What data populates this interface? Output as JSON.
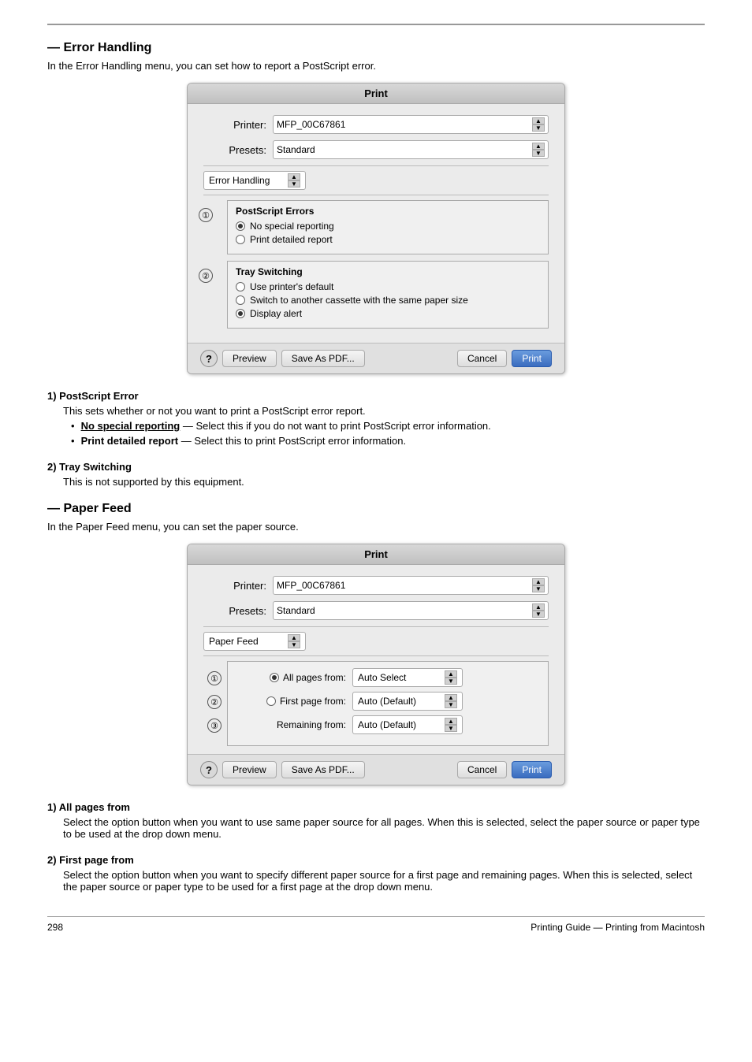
{
  "page": {
    "footer_left": "298",
    "footer_right": "Printing Guide — Printing from Macintosh"
  },
  "error_handling": {
    "section_title": "— Error Handling",
    "intro": "In the Error Handling menu, you can set how to report a PostScript error.",
    "dialog": {
      "title": "Print",
      "printer_label": "Printer:",
      "printer_value": "MFP_00C67861",
      "presets_label": "Presets:",
      "presets_value": "Standard",
      "panel_value": "Error Handling",
      "postscript_group_label": "PostScript Errors",
      "radio1_label": "No special reporting",
      "radio1_checked": true,
      "radio2_label": "Print detailed report",
      "radio2_checked": false,
      "tray_group_label": "Tray Switching",
      "tray_radio1_label": "Use printer's default",
      "tray_radio1_checked": false,
      "tray_radio2_label": "Switch to another cassette with the same paper size",
      "tray_radio2_checked": false,
      "tray_radio3_label": "Display alert",
      "tray_radio3_checked": true,
      "preview_btn": "Preview",
      "save_pdf_btn": "Save As PDF...",
      "cancel_btn": "Cancel",
      "print_btn": "Print"
    },
    "annotation1": "①",
    "annotation2": "②",
    "desc1_heading": "1) PostScript Error",
    "desc1_para": "This sets whether or not you want to print a PostScript error report.",
    "desc1_bullet1_bold": "No special reporting",
    "desc1_bullet1_rest": " — Select this if you do not want to print PostScript error information.",
    "desc1_bullet2_bold": "Print detailed report",
    "desc1_bullet2_rest": " — Select this to print PostScript error information.",
    "desc2_heading": "2) Tray Switching",
    "desc2_para": "This is not supported by this equipment."
  },
  "paper_feed": {
    "section_title": "— Paper Feed",
    "intro": "In the Paper Feed menu, you can set the paper source.",
    "dialog": {
      "title": "Print",
      "printer_label": "Printer:",
      "printer_value": "MFP_00C67861",
      "presets_label": "Presets:",
      "presets_value": "Standard",
      "panel_value": "Paper Feed",
      "row1_radio_label": "All pages from:",
      "row1_value": "Auto Select",
      "row1_checked": true,
      "row2_radio_label": "First page from:",
      "row2_value": "Auto (Default)",
      "row2_checked": false,
      "row3_label": "Remaining from:",
      "row3_value": "Auto (Default)",
      "preview_btn": "Preview",
      "save_pdf_btn": "Save As PDF...",
      "cancel_btn": "Cancel",
      "print_btn": "Print"
    },
    "annotation1": "①",
    "annotation2": "②",
    "annotation3": "③",
    "desc1_heading": "1) All pages from",
    "desc1_para": "Select the option button when you want to use same paper source for all pages.  When this is selected, select the paper source or paper type to be used at the drop down menu.",
    "desc2_heading": "2) First page from",
    "desc2_para": "Select the option button when you want to specify different paper source for a first page and remaining pages.  When this is selected, select the paper source or paper type to be used for a first page at the drop down menu."
  }
}
